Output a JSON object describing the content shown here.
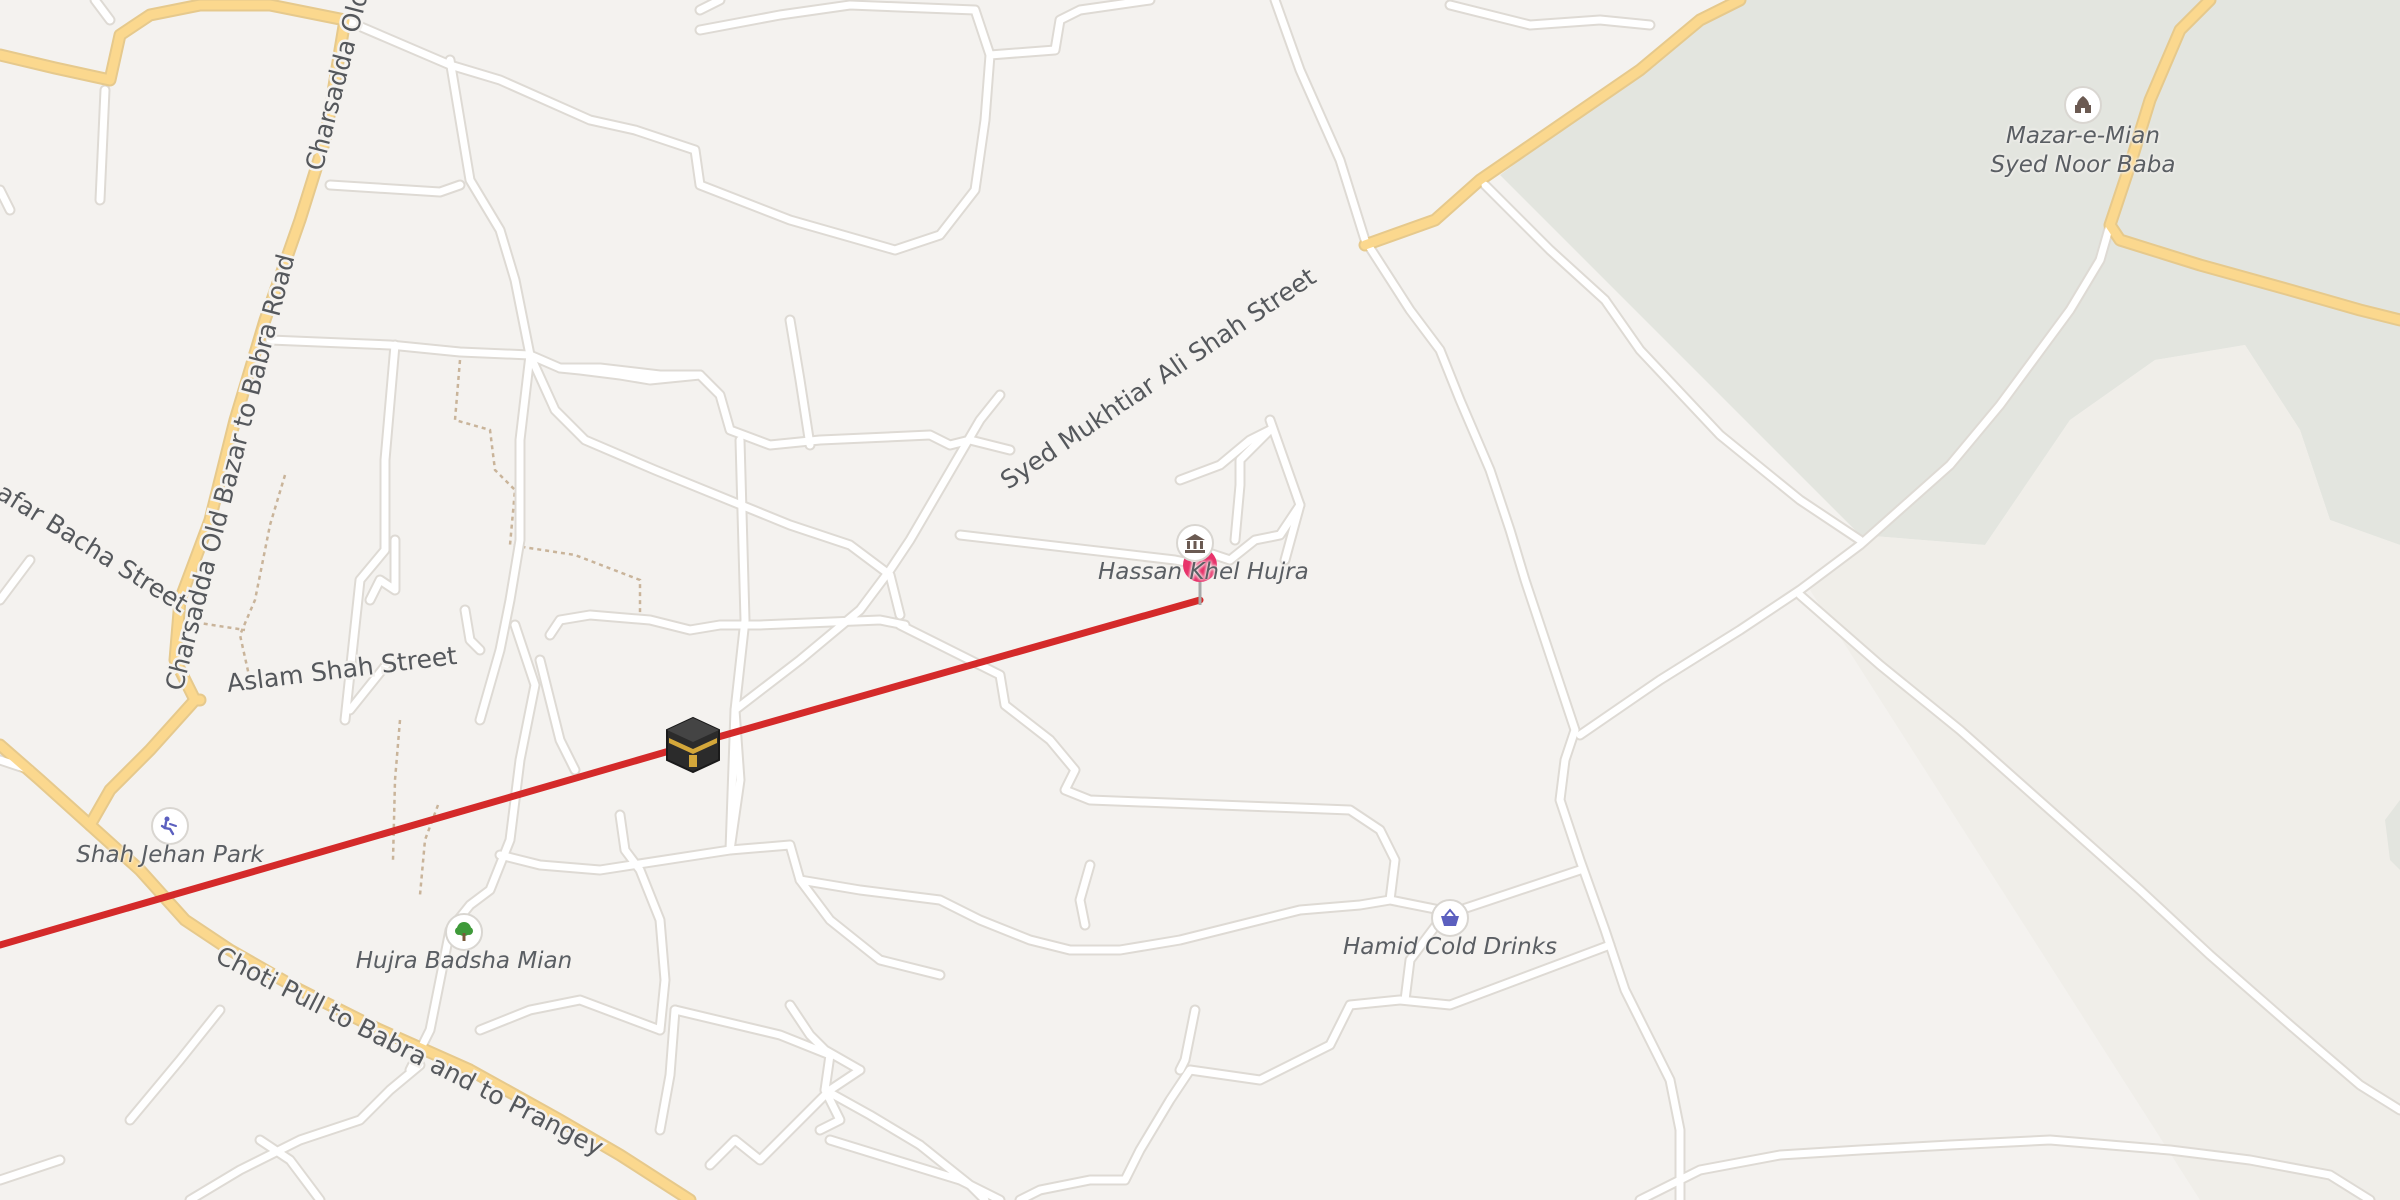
{
  "map": {
    "streets": {
      "charsadda_old_bazar": "Charsadda Old Bazar to Babra Road",
      "charsadda_old_top": "Charsadda Old",
      "afar_bacha": "afar Bacha Street",
      "aslam_shah": "Aslam Shah Street",
      "syed_mukhtiar": "Syed Mukhtiar Ali Shah Street",
      "choti_pull": "Choti Pull to Babra and to Prangey"
    },
    "pois": {
      "hassan_hujra": {
        "name": "Hassan Khel Hujra",
        "icon": "monument-icon"
      },
      "mazar": {
        "line1": "Mazar-e-Mian",
        "line2": "Syed Noor Baba",
        "icon": "shrine-icon"
      },
      "shah_jehan_park": {
        "name": "Shah Jehan Park",
        "icon": "playground-icon"
      },
      "hujra_badsha": {
        "name": "Hujra Badsha Mian",
        "icon": "tree-icon"
      },
      "hamid_cold_drinks": {
        "name": "Hamid Cold Drinks",
        "icon": "shopping-basket-icon"
      },
      "kaaba": {
        "icon": "kaaba-icon"
      }
    },
    "route_color": "#d42a2a",
    "pin_color": "#e8336b"
  }
}
